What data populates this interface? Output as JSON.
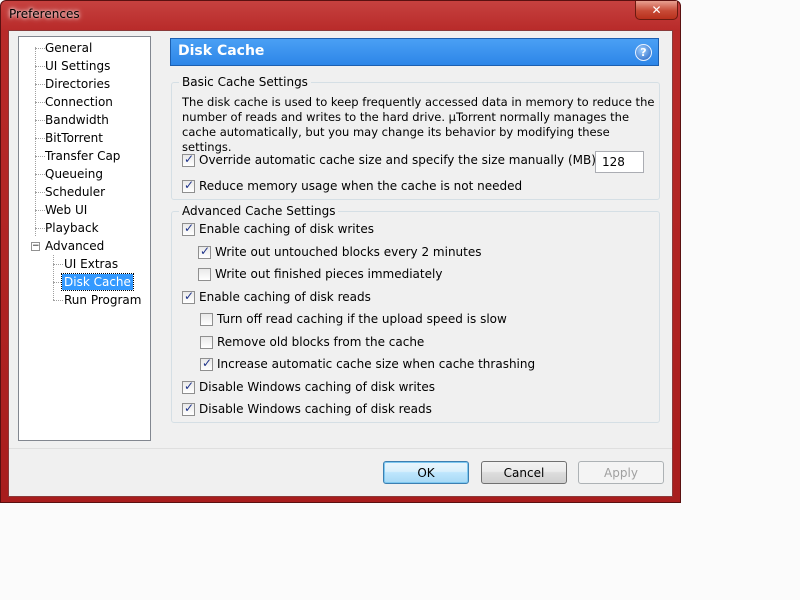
{
  "window": {
    "title": "Preferences",
    "close_glyph": "✕"
  },
  "tree": {
    "items": [
      {
        "label": "General"
      },
      {
        "label": "UI Settings"
      },
      {
        "label": "Directories"
      },
      {
        "label": "Connection"
      },
      {
        "label": "Bandwidth"
      },
      {
        "label": "BitTorrent"
      },
      {
        "label": "Transfer Cap"
      },
      {
        "label": "Queueing"
      },
      {
        "label": "Scheduler"
      },
      {
        "label": "Web UI"
      },
      {
        "label": "Playback"
      },
      {
        "label": "Advanced",
        "expander": "−"
      }
    ],
    "children": [
      {
        "label": "UI Extras"
      },
      {
        "label": "Disk Cache",
        "selected": true
      },
      {
        "label": "Run Program"
      }
    ]
  },
  "header": {
    "title": "Disk Cache",
    "help_glyph": "?",
    "color": "#3a92ee"
  },
  "basic": {
    "label": "Basic Cache Settings",
    "description": "The disk cache is used to keep frequently accessed data in memory to reduce the number of reads and writes to the hard drive. µTorrent normally manages the cache automatically, but you may change its behavior by modifying these settings.",
    "override_label": "Override automatic cache size and specify the size manually (MB):",
    "override_checked": true,
    "cache_size": "128",
    "reduce_label": "Reduce memory usage when the cache is not needed",
    "reduce_checked": true
  },
  "advanced": {
    "label": "Advanced Cache Settings",
    "options": [
      {
        "label": "Enable caching of disk writes",
        "checked": true,
        "indent": 0
      },
      {
        "label": "Write out untouched blocks every 2 minutes",
        "checked": true,
        "indent": 1
      },
      {
        "label": "Write out finished pieces immediately",
        "checked": false,
        "indent": 1
      },
      {
        "label": "Enable caching of disk reads",
        "checked": true,
        "indent": 0
      },
      {
        "label": "Turn off read caching if the upload speed is slow",
        "checked": false,
        "indent": 1
      },
      {
        "label": "Remove old blocks from the cache",
        "checked": false,
        "indent": 1
      },
      {
        "label": "Increase automatic cache size when cache thrashing",
        "checked": true,
        "indent": 1
      },
      {
        "label": "Disable Windows caching of disk writes",
        "checked": true,
        "indent": 0
      },
      {
        "label": "Disable Windows caching of disk reads",
        "checked": true,
        "indent": 0
      }
    ]
  },
  "buttons": {
    "ok": "OK",
    "cancel": "Cancel",
    "apply": "Apply"
  },
  "colors": {
    "title_bar": "#b82a29",
    "selection": "#3399ff"
  }
}
